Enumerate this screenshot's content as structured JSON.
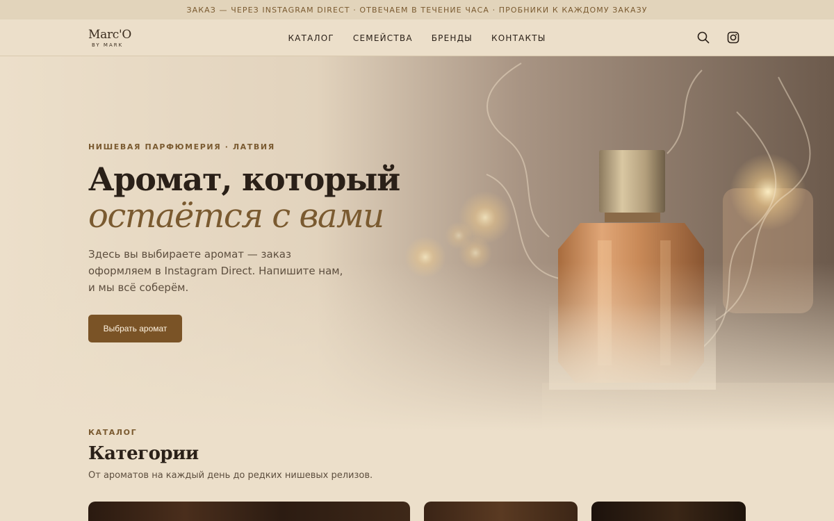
{
  "announcement": "ЗАКАЗ — ЧЕРЕЗ INSTAGRAM DIRECT · ОТВЕЧАЕМ В ТЕЧЕНИЕ ЧАСА · ПРОБНИКИ К КАЖДОМУ ЗАКАЗУ",
  "brand": {
    "name": "Marc'O",
    "sub": "BY MARK"
  },
  "nav": {
    "items": [
      {
        "label": "КАТАЛОГ"
      },
      {
        "label": "СЕМЕЙСТВА"
      },
      {
        "label": "БРЕНДЫ"
      },
      {
        "label": "КОНТАКТЫ"
      }
    ]
  },
  "header_icons": {
    "search": "search-icon",
    "instagram": "instagram-icon"
  },
  "hero": {
    "eyebrow": "НИШЕВАЯ ПАРФЮМЕРИЯ · ЛАТВИЯ",
    "title_line1": "Аромат, который",
    "title_line2": "остаётся с вами",
    "text": "Здесь вы выбираете аромат — заказ оформляем в Instagram Direct. Напишите нам, и мы всё соберём.",
    "cta_label": "Выбрать аромат"
  },
  "catalog": {
    "eyebrow": "КАТАЛОГ",
    "title": "Категории",
    "subtitle": "От ароматов на каждый день до редких нишевых релизов."
  },
  "colors": {
    "background": "#ecdfca",
    "accent": "#7a5a30",
    "button": "#7a5326",
    "text": "#2a2018"
  }
}
